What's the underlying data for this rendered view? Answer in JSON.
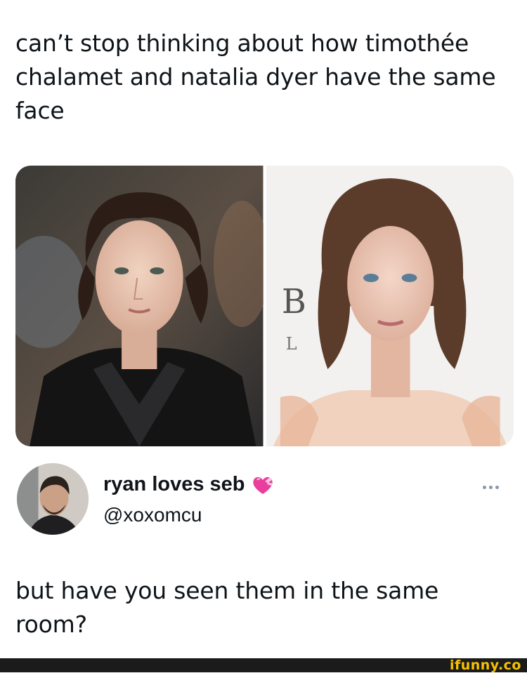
{
  "post": {
    "caption": "can’t stop thinking about how timothée chalamet and natalia dyer have the same face",
    "images": [
      {
        "icon": "portrait-photo-left"
      },
      {
        "icon": "portrait-photo-right"
      }
    ]
  },
  "author": {
    "display_name": "ryan loves seb",
    "emoji_icon": "heart-with-ribbon-icon",
    "handle": "@xoxomcu",
    "more_icon": "more-options-icon"
  },
  "tweet": {
    "text": "but have you seen them in the same room?"
  },
  "footer": {
    "watermark": "ifunny.co",
    "accent_color": "#f6c200"
  },
  "colors": {
    "text": "#0f1419",
    "muted": "#8b98a5",
    "footer_bg": "#1b1b1b"
  }
}
